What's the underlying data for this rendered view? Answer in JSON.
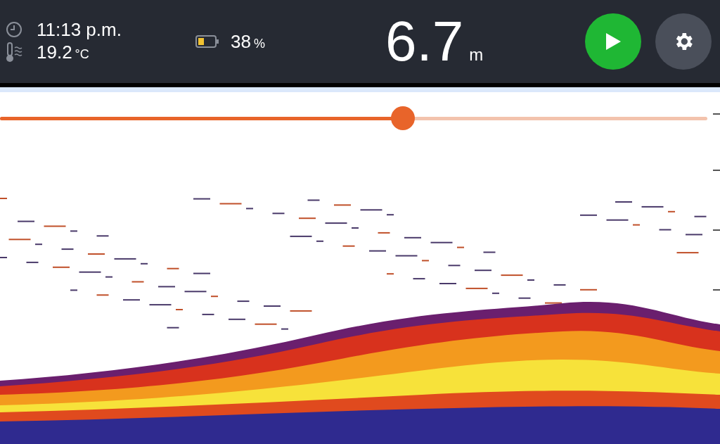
{
  "status": {
    "time": "11:13 p.m.",
    "temperature": "19.2",
    "temperature_unit": "°C",
    "battery": "38",
    "battery_unit": "%"
  },
  "depth": {
    "value": "6.7",
    "unit": "m"
  },
  "play_button": {
    "on": true
  },
  "range_slider": {
    "level": 0.57
  }
}
